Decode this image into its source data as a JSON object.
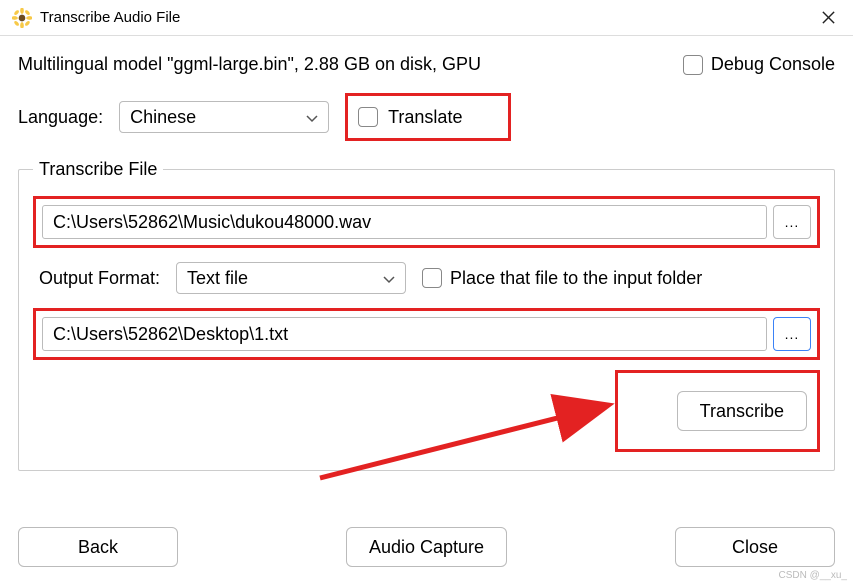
{
  "window": {
    "title": "Transcribe Audio File"
  },
  "header": {
    "model_info": "Multilingual model \"ggml-large.bin\", 2.88 GB on disk, GPU",
    "debug_label": "Debug Console"
  },
  "language_row": {
    "label": "Language:",
    "selected": "Chinese",
    "translate_label": "Translate"
  },
  "transcribe_section": {
    "legend": "Transcribe File",
    "input_path": "C:\\Users\\52862\\Music\\dukou48000.wav",
    "output_format_label": "Output Format:",
    "output_format_selected": "Text file",
    "place_label": "Place that file to the input folder",
    "output_path": "C:\\Users\\52862\\Desktop\\1.txt",
    "browse_label": "...",
    "transcribe_button": "Transcribe"
  },
  "footer": {
    "back": "Back",
    "audio_capture": "Audio Capture",
    "close": "Close"
  },
  "watermark": "CSDN @__xu_"
}
